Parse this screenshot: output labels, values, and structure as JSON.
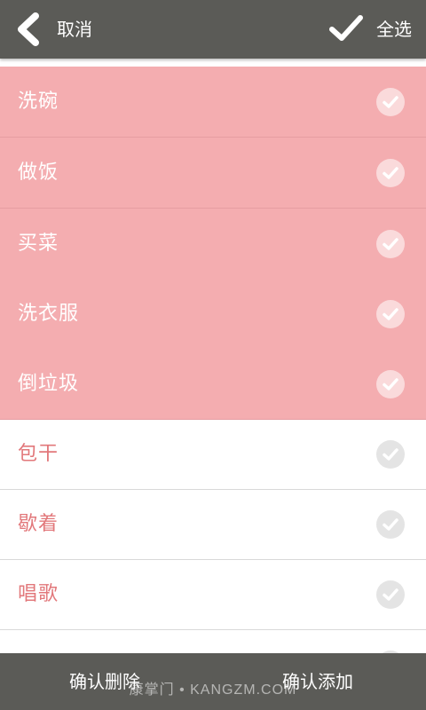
{
  "header": {
    "back_label": "取消",
    "select_all_label": "全选"
  },
  "colors": {
    "bar": "#5b5b57",
    "checked_row": "#f4adb0",
    "unchecked_text": "#e2787b"
  },
  "list": {
    "items": [
      {
        "label": "洗碗",
        "checked": true
      },
      {
        "label": "做饭",
        "checked": true
      },
      {
        "label": "买菜",
        "checked": true
      },
      {
        "label": "洗衣服",
        "checked": true
      },
      {
        "label": "倒垃圾",
        "checked": true
      },
      {
        "label": "包干",
        "checked": false
      },
      {
        "label": "歇着",
        "checked": false
      },
      {
        "label": "唱歌",
        "checked": false
      },
      {
        "label": "",
        "checked": false
      }
    ]
  },
  "footer": {
    "delete_label": "确认删除",
    "add_label": "确认添加"
  },
  "watermark": "康掌门 • KANGZM.COM"
}
